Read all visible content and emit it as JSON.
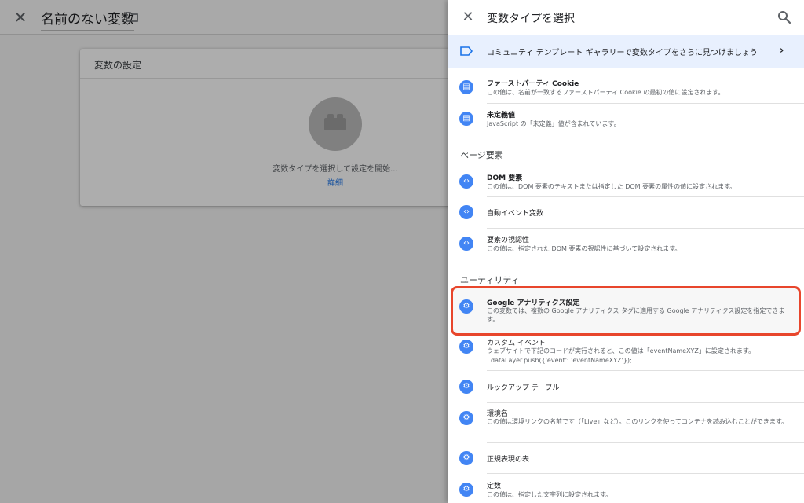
{
  "background": {
    "title": "名前のない変数",
    "card_header": "変数の設定",
    "card_message": "変数タイプを選択して設定を開始...",
    "card_link": "詳細"
  },
  "panel": {
    "title": "変数タイプを選択",
    "gallery_text": "コミュニティ テンプレート ギャラリーで変数タイプをさらに見つけましょう",
    "sections": {
      "page_elements": "ページ要素",
      "utilities": "ユーティリティ"
    },
    "items": [
      {
        "title": "ファーストパーティ Cookie",
        "desc": "この値は、名前が一致するファーストパーティ Cookie の最初の値に設定されます。",
        "icon": "document-icon"
      },
      {
        "title": "未定義値",
        "desc": "JavaScript の「未定義」値が含まれています。",
        "icon": "document-icon"
      },
      {
        "title": "DOM 要素",
        "desc": "この値は、DOM 要素のテキストまたは指定した DOM 要素の属性の値に設定されます。",
        "icon": "code-icon"
      },
      {
        "title": "自動イベント変数",
        "desc": "",
        "icon": "code-icon"
      },
      {
        "title": "要素の視認性",
        "desc": "この値は、指定された DOM 要素の視認性に基づいて設定されます。",
        "icon": "code-icon"
      },
      {
        "title": "Google アナリティクス設定",
        "desc": "この変数では、複数の Google アナリティクス タグに適用する Google アナリティクス設定を指定できます。",
        "icon": "gear-icon"
      },
      {
        "title": "カスタム イベント",
        "desc": "ウェブサイトで下記のコードが実行されると、この値は「eventNameXYZ」に設定されます。",
        "desc2": "dataLayer.push({'event': 'eventNameXYZ'});",
        "icon": "gear-icon"
      },
      {
        "title": "ルックアップ テーブル",
        "desc": "",
        "icon": "gear-icon"
      },
      {
        "title": "環境名",
        "desc": "この値は環境リンクの名前です（「Live」など）。このリンクを使ってコンテナを読み込むことができます。",
        "icon": "gear-icon"
      },
      {
        "title": "正規表現の表",
        "desc": "",
        "icon": "gear-icon"
      },
      {
        "title": "定数",
        "desc": "この値は、指定した文字列に設定されます。",
        "icon": "gear-icon"
      }
    ]
  },
  "colors": {
    "accent": "#4285f4",
    "highlight": "#e8462c",
    "gallery_bg": "#e8f0fe"
  }
}
